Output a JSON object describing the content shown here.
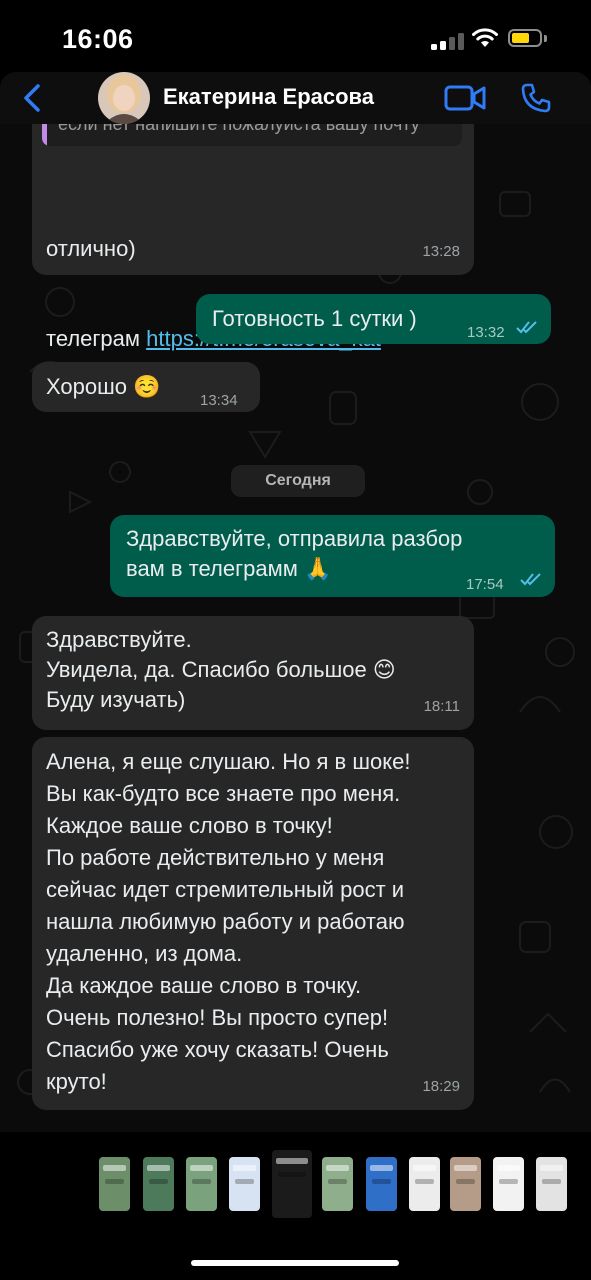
{
  "status_bar": {
    "time": "16:06"
  },
  "header": {
    "contact_name": "Екатерина Ерасова"
  },
  "messages": [
    {
      "direction": "in",
      "quote": "если нет напишите пожалуйста вашу почту",
      "lines": [
        "отлично)",
        "телеграм "
      ],
      "link": "https://t.me/erasova_kat",
      "time": "13:28"
    },
    {
      "direction": "out",
      "text": "Готовность 1 сутки )",
      "time": "13:32",
      "status": "read"
    },
    {
      "direction": "in",
      "text": "Хорошо ☺️",
      "time": "13:34"
    },
    {
      "direction": "out",
      "text": "Здравствуйте, отправила разбор\nвам в телеграмм 🙏",
      "time": "17:54",
      "status": "read"
    },
    {
      "direction": "in",
      "text": "Здравствуйте.\nУвидела, да. Спасибо большое 😊\nБуду изучать)",
      "time": "18:11"
    },
    {
      "direction": "in",
      "text": "Алена, я еще слушаю. Но я в шоке!\nВы как-будто все знаете про меня.\nКаждое ваше слово в точку!\nПо работе действительно у меня\nсейчас идет стремительный рост и\nнашла любимую работу и работаю\nудаленно, из дома.\nДа каждое ваше слово в точку.\nОчень полезно! Вы просто супер!\nСпасибо уже хочу сказать! Очень\nкруто!",
      "time": "18:29"
    }
  ],
  "date_separator": "Сегодня",
  "icons": {
    "back": "chevron-left-icon",
    "video": "video-call-icon",
    "call": "phone-icon",
    "read_receipt": "double-check-icon"
  },
  "colors": {
    "accent": "#2f7cf6",
    "incoming_bubble": "#272727",
    "outgoing_bubble": "#005c4b",
    "link": "#53bdeb",
    "read_check": "#53bdeb",
    "battery": "#ffd60a"
  },
  "thumbnails_count": 13
}
